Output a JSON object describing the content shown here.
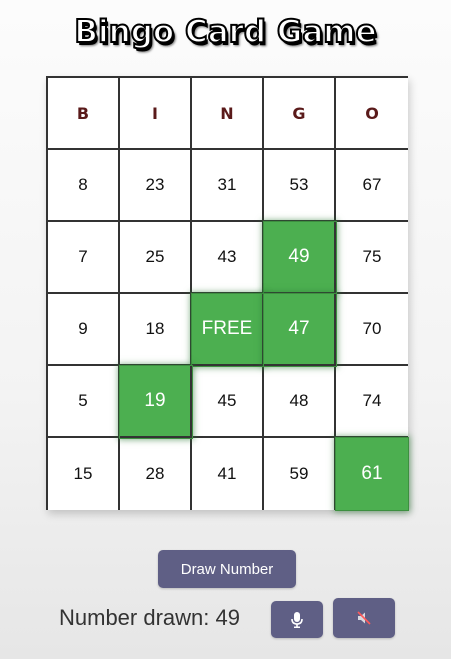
{
  "title": "Bingo Card Game",
  "card": {
    "headers": [
      "B",
      "I",
      "N",
      "G",
      "O"
    ],
    "rows": [
      [
        {
          "value": "8",
          "marked": false
        },
        {
          "value": "23",
          "marked": false
        },
        {
          "value": "31",
          "marked": false
        },
        {
          "value": "53",
          "marked": false
        },
        {
          "value": "67",
          "marked": false
        }
      ],
      [
        {
          "value": "7",
          "marked": false
        },
        {
          "value": "25",
          "marked": false
        },
        {
          "value": "43",
          "marked": false
        },
        {
          "value": "49",
          "marked": true
        },
        {
          "value": "75",
          "marked": false
        }
      ],
      [
        {
          "value": "9",
          "marked": false
        },
        {
          "value": "18",
          "marked": false
        },
        {
          "value": "FREE",
          "marked": true
        },
        {
          "value": "47",
          "marked": true
        },
        {
          "value": "70",
          "marked": false
        }
      ],
      [
        {
          "value": "5",
          "marked": false
        },
        {
          "value": "19",
          "marked": true
        },
        {
          "value": "45",
          "marked": false
        },
        {
          "value": "48",
          "marked": false
        },
        {
          "value": "74",
          "marked": false
        }
      ],
      [
        {
          "value": "15",
          "marked": false
        },
        {
          "value": "28",
          "marked": false
        },
        {
          "value": "41",
          "marked": false
        },
        {
          "value": "59",
          "marked": false
        },
        {
          "value": "61",
          "marked": true
        }
      ]
    ]
  },
  "controls": {
    "draw_label": "Draw Number",
    "number_drawn_text": "Number drawn: 49",
    "mic_icon": "microphone-icon",
    "mute_icon": "speaker-muted-icon"
  },
  "colors": {
    "marked_cell": "#4caf50",
    "button": "#5f5f85",
    "header_text": "#5a1a1a"
  }
}
